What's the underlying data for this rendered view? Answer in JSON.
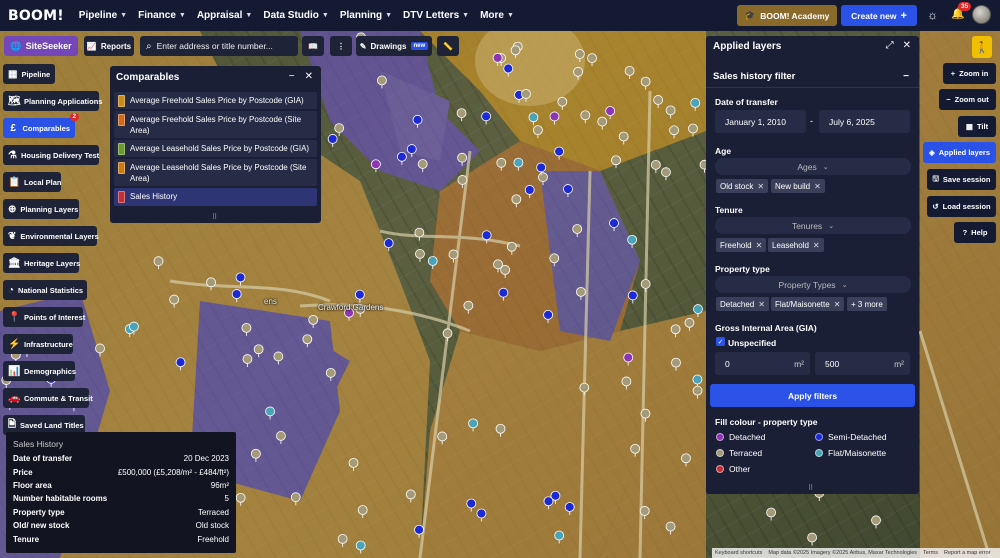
{
  "nav": {
    "logo": "BOOM!",
    "items": [
      {
        "label": "Pipeline"
      },
      {
        "label": "Finance"
      },
      {
        "label": "Appraisal"
      },
      {
        "label": "Data Studio"
      },
      {
        "label": "Planning"
      },
      {
        "label": "DTV Letters"
      },
      {
        "label": "More"
      }
    ],
    "academy_label": "BOOM! Academy",
    "create_label": "Create new",
    "notification_count": "35"
  },
  "toolbar": {
    "siteseeker_label": "SiteSeeker",
    "reports_label": "Reports",
    "search_placeholder": "Enter address or title number...",
    "drawings_label": "Drawings",
    "drawings_badge": "new"
  },
  "sidebar": {
    "items": [
      {
        "label": "Pipeline",
        "icon": "grid-icon"
      },
      {
        "label": "Planning Applications",
        "icon": "map-icon"
      },
      {
        "label": "Comparables",
        "icon": "pound-icon",
        "badge": "2",
        "active": true
      },
      {
        "label": "Housing Delivery Test",
        "icon": "flask-icon"
      },
      {
        "label": "Local Plan",
        "icon": "clipboard-icon"
      },
      {
        "label": "Planning Layers",
        "icon": "compass-icon"
      },
      {
        "label": "Environmental Layers",
        "icon": "leaf-icon"
      },
      {
        "label": "Heritage Layers",
        "icon": "building-icon"
      },
      {
        "label": "National Statistics",
        "icon": "pie-icon"
      },
      {
        "label": "Points of Interest",
        "icon": "pin-icon"
      },
      {
        "label": "Infrastructure",
        "icon": "pylon-icon"
      },
      {
        "label": "Demographics",
        "icon": "chart-icon"
      },
      {
        "label": "Commute & Transit",
        "icon": "car-icon"
      },
      {
        "label": "Saved Land Titles",
        "icon": "doc-icon"
      }
    ]
  },
  "comparables": {
    "title": "Comparables",
    "rows": [
      {
        "label": "Average Freehold Sales Price by Postcode (GIA)",
        "color": "#c98a1a"
      },
      {
        "label": "Average Freehold Sales Price by Postcode (Site Area)",
        "color": "#d06a1a"
      },
      {
        "label": "Average Leasehold Sales Price by Postcode (GIA)",
        "color": "#6a9a2a"
      },
      {
        "label": "Average Leasehold Sales Price by Postcode (Site Area)",
        "color": "#c97a10"
      },
      {
        "label": "Sales History",
        "color": "#c0303a",
        "active": true
      }
    ]
  },
  "sales_card": {
    "title": "Sales History",
    "rows": [
      {
        "k": "Date of transfer",
        "v": "20 Dec 2023"
      },
      {
        "k": "Price",
        "v": "£500,000 (£5,208/m² - £484/ft²)"
      },
      {
        "k": "Floor area",
        "v": "96m²"
      },
      {
        "k": "Number habitable rooms",
        "v": "5"
      },
      {
        "k": "Property type",
        "v": "Terraced"
      },
      {
        "k": "Old/ new stock",
        "v": "Old stock"
      },
      {
        "k": "Tenure",
        "v": "Freehold"
      }
    ]
  },
  "applied_layers": {
    "title": "Applied layers",
    "filter_title": "Sales history filter",
    "date_label": "Date of transfer",
    "date_from": "January 1, 2010",
    "date_sep": "-",
    "date_to": "July 6, 2025",
    "age_label": "Age",
    "age_dropdown": "Ages",
    "age_chips": [
      "Old stock",
      "New build"
    ],
    "tenure_label": "Tenure",
    "tenure_dropdown": "Tenures",
    "tenure_chips": [
      "Freehold",
      "Leasehold"
    ],
    "ptype_label": "Property type",
    "ptype_dropdown": "Property Types",
    "ptype_chips": [
      "Detached",
      "Flat/Maisonette"
    ],
    "ptype_more": "+ 3 more",
    "gia_label": "Gross Internal Area (GIA)",
    "unspecified_label": "Unspecified",
    "gia_min": "0",
    "gia_max": "500",
    "unit": "m²",
    "apply_label": "Apply filters",
    "fill_label": "Fill colour - property type",
    "legend": [
      {
        "label": "Detached",
        "color": "#8e35b5"
      },
      {
        "label": "Semi-Detached",
        "color": "#1c2ad6"
      },
      {
        "label": "Terraced",
        "color": "#a59a78"
      },
      {
        "label": "Flat/Maisonette",
        "color": "#4aa3b8"
      },
      {
        "label": "Other",
        "color": "#c0303a"
      }
    ]
  },
  "map_controls": {
    "zoom_in": "Zoom in",
    "zoom_out": "Zoom out",
    "tilt": "Tilt",
    "applied_layers": "Applied layers",
    "save_session": "Save session",
    "load_session": "Load session",
    "help": "Help"
  },
  "map_labels": {
    "crawford": "Crawford Gardens",
    "ens": "ens"
  },
  "footer": {
    "shortcuts": "Keyboard shortcuts",
    "mapdata": "Map data ©2025 Imagery ©2025 Airbus, Maxar Technologies",
    "terms": "Terms",
    "report": "Report a map error"
  }
}
